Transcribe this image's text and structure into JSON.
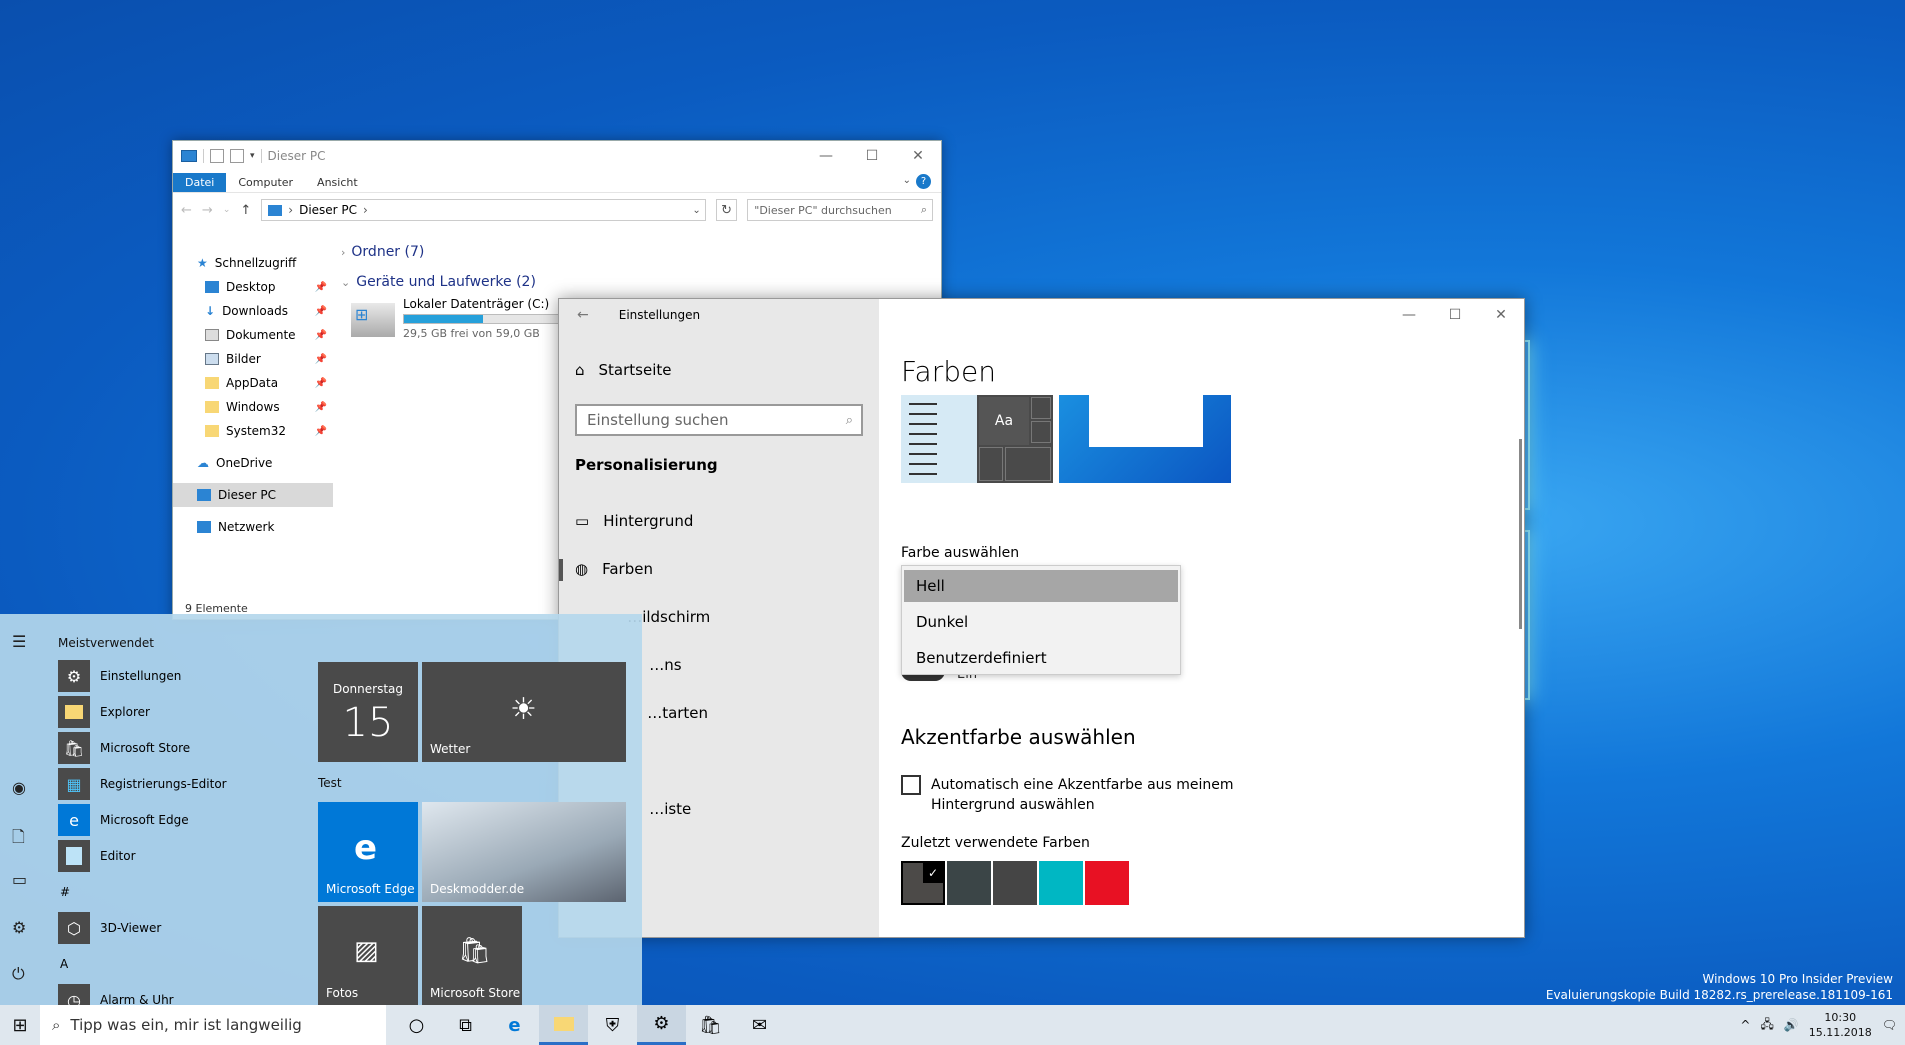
{
  "explorer": {
    "title": "Dieser PC",
    "ribbon_tabs": [
      "Datei",
      "Computer",
      "Ansicht"
    ],
    "address": "Dieser PC",
    "search_placeholder": "\"Dieser PC\" durchsuchen",
    "nav": {
      "quick_access": "Schnellzugriff",
      "pinned": [
        "Desktop",
        "Downloads",
        "Dokumente",
        "Bilder",
        "AppData",
        "Windows",
        "System32"
      ],
      "onedrive": "OneDrive",
      "this_pc": "Dieser PC",
      "network": "Netzwerk"
    },
    "groups": {
      "folders": "Ordner (7)",
      "drives": "Geräte und Laufwerke (2)"
    },
    "drive": {
      "name": "Lokaler Datenträger (C:)",
      "free": "29,5 GB frei von 59,0 GB",
      "used_fraction": 0.5
    },
    "status": "9 Elemente"
  },
  "settings": {
    "window_title": "Einstellungen",
    "home": "Startseite",
    "search_placeholder": "Einstellung suchen",
    "section": "Personalisierung",
    "nav": [
      "Hintergrund",
      "Farben",
      "Sperrbildschirm",
      "Designs",
      "Starten",
      "Taskleiste"
    ],
    "nav_visible": [
      "Hintergrund",
      "Farben",
      "…ildschirm",
      "…ns",
      "…tarten",
      "…iste"
    ],
    "page_title": "Farben",
    "preview_text": "Aa",
    "color_label": "Farbe auswählen",
    "dropdown_options": [
      "Hell",
      "Dunkel",
      "Benutzerdefiniert"
    ],
    "dropdown_selected": "Hell",
    "toggle_partial": "Ein",
    "accent_heading": "Akzentfarbe auswählen",
    "auto_accent": "Automatisch eine Akzentfarbe aus meinem Hintergrund auswählen",
    "recent_label": "Zuletzt verwendete Farben",
    "recent_colors": [
      "#4c4a48",
      "#3b4547",
      "#454545",
      "#00b7c3",
      "#e81123"
    ]
  },
  "start": {
    "most_used": "Meistverwendet",
    "apps": [
      "Einstellungen",
      "Explorer",
      "Microsoft Store",
      "Registrierungs-Editor",
      "Microsoft Edge",
      "Editor"
    ],
    "letter_hash": "#",
    "hash_apps": [
      "3D-Viewer"
    ],
    "letter_a": "A",
    "a_apps": [
      "Alarm & Uhr"
    ],
    "tiles": {
      "calendar_day": "Donnerstag",
      "calendar_date": "15",
      "weather": "Wetter",
      "group": "Test",
      "edge": "Microsoft Edge",
      "deskmodder": "Deskmodder.de",
      "photos": "Fotos",
      "store": "Microsoft Store"
    }
  },
  "taskbar": {
    "search_placeholder": "Tipp was ein, mir ist langweilig",
    "time": "10:30",
    "date": "15.11.2018"
  },
  "watermark": {
    "line1": "Windows 10 Pro Insider Preview",
    "line2": "Evaluierungskopie Build 18282.rs_prerelease.181109-161"
  }
}
